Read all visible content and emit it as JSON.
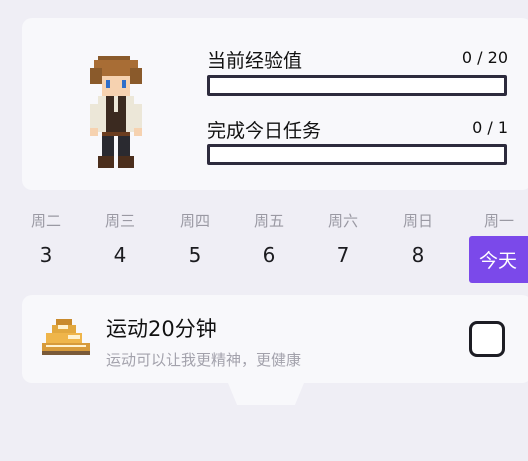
{
  "profile": {
    "exp_label": "当前经验值",
    "exp_value": "0 / 20",
    "exp_progress": 0,
    "task_label": "完成今日任务",
    "task_value": "0 / 1",
    "task_progress": 0
  },
  "week": {
    "days": [
      {
        "weekday": "周二",
        "date": "3"
      },
      {
        "weekday": "周三",
        "date": "4"
      },
      {
        "weekday": "周四",
        "date": "5"
      },
      {
        "weekday": "周五",
        "date": "6"
      },
      {
        "weekday": "周六",
        "date": "7"
      },
      {
        "weekday": "周日",
        "date": "8"
      },
      {
        "weekday": "周一",
        "date": ""
      }
    ],
    "today_label": "今天"
  },
  "task": {
    "icon": "sneaker-icon",
    "title": "运动20分钟",
    "description": "运动可以让我更精神，更健康",
    "checked": false
  },
  "colors": {
    "accent": "#7b49ea",
    "background": "#efeef5",
    "card": "#f8f8fb",
    "border": "#2d2b3d"
  }
}
